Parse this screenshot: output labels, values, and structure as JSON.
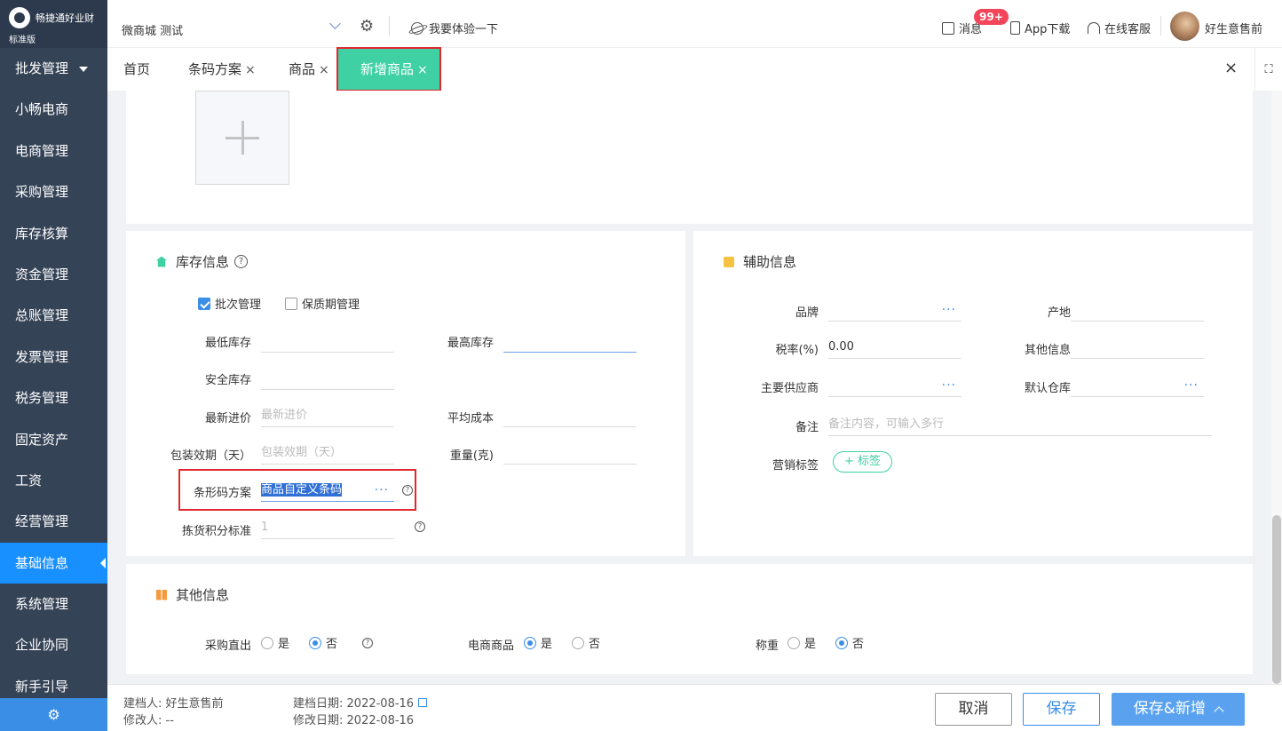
{
  "app": {
    "brand": "畅捷通好业财",
    "edition": "标准版"
  },
  "sidebar": {
    "items": [
      {
        "label": "批发管理",
        "name": "sidebar-item-wholesale"
      },
      {
        "label": "小畅电商",
        "name": "sidebar-item-xiaochang-ecommerce"
      },
      {
        "label": "电商管理",
        "name": "sidebar-item-ecommerce"
      },
      {
        "label": "采购管理",
        "name": "sidebar-item-purchase"
      },
      {
        "label": "库存核算",
        "name": "sidebar-item-inventory"
      },
      {
        "label": "资金管理",
        "name": "sidebar-item-funds"
      },
      {
        "label": "总账管理",
        "name": "sidebar-item-ledger"
      },
      {
        "label": "发票管理",
        "name": "sidebar-item-invoice"
      },
      {
        "label": "税务管理",
        "name": "sidebar-item-tax"
      },
      {
        "label": "固定资产",
        "name": "sidebar-item-fixed-assets"
      },
      {
        "label": "工资",
        "name": "sidebar-item-salary"
      },
      {
        "label": "经营管理",
        "name": "sidebar-item-operations"
      },
      {
        "label": "基础信息",
        "name": "sidebar-item-basic-info"
      },
      {
        "label": "系统管理",
        "name": "sidebar-item-system"
      },
      {
        "label": "企业协同",
        "name": "sidebar-item-collaboration"
      },
      {
        "label": "新手引导",
        "name": "sidebar-item-guide"
      }
    ],
    "active_index": 12
  },
  "topbar": {
    "store": "微商城 测试",
    "try_label": "我要体验一下",
    "messages_label": "消息",
    "messages_badge": "99+",
    "app_download_label": "App下载",
    "support_label": "在线客服",
    "username": "好生意售前"
  },
  "tabs": [
    {
      "label": "首页",
      "closable": false
    },
    {
      "label": "条码方案",
      "closable": true
    },
    {
      "label": "商品",
      "closable": true
    },
    {
      "label": "新增商品",
      "closable": true,
      "active": true
    }
  ],
  "close_symbol": "×",
  "inventory": {
    "title": "库存信息",
    "batch_label": "批次管理",
    "batch_checked": true,
    "shelf_label": "保质期管理",
    "shelf_checked": false,
    "min_stock_label": "最低库存",
    "max_stock_label": "最高库存",
    "safety_stock_label": "安全库存",
    "latest_price_label": "最新进价",
    "latest_price_placeholder": "最新进价",
    "avg_cost_label": "平均成本",
    "package_days_label": "包装效期（天）",
    "package_days_placeholder": "包装效期（天）",
    "weight_label": "重量(克)",
    "barcode_label": "条形码方案",
    "barcode_value": "商品自定义条码",
    "picking_label": "拣货积分标准",
    "picking_value": "1"
  },
  "aux": {
    "title": "辅助信息",
    "brand_label": "品牌",
    "origin_label": "产地",
    "tax_label": "税率(%)",
    "tax_value": "0.00",
    "other_label": "其他信息",
    "supplier_label": "主要供应商",
    "warehouse_label": "默认仓库",
    "remark_label": "备注",
    "remark_placeholder": "备注内容，可输入多行",
    "marketing_label": "营销标签",
    "tag_button": "+ 标签"
  },
  "other": {
    "title": "其他信息",
    "direct_purchase_label": "采购直出",
    "ecommerce_label": "电商商品",
    "weigh_label": "称重",
    "yes": "是",
    "no": "否",
    "direct_purchase": "否",
    "ecommerce": "是",
    "weigh": "否"
  },
  "footer": {
    "creator_label": "建档人:",
    "creator": "好生意售前",
    "modifier_label": "修改人:",
    "modifier": "--",
    "created_label": "建档日期:",
    "created_date": "2022-08-16",
    "modified_label": "修改日期:",
    "modified_date": "2022-08-16",
    "cancel": "取消",
    "save": "保存",
    "save_new": "保存&新增"
  },
  "colors": {
    "sidebar_bg": "#354357",
    "active_blue": "#1890ff",
    "active_tab": "#3fd0a3",
    "highlight_red": "#e0292f"
  }
}
